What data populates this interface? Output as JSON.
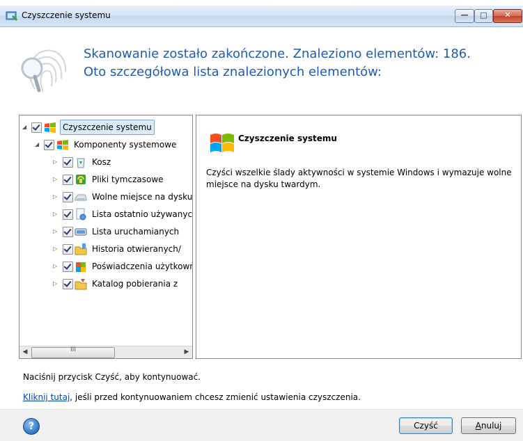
{
  "window": {
    "title": "Czyszczenie systemu"
  },
  "header": {
    "line1": "Skanowanie zostało zakończone. Znaleziono elementów: 186.",
    "line2": "Oto szczegółowa lista znalezionych elementów:"
  },
  "tree": {
    "root": {
      "label": "Czyszczenie systemu",
      "checked": true,
      "expanded": true
    },
    "group": {
      "label": "Komponenty systemowe",
      "checked": true,
      "expanded": true
    },
    "items": [
      {
        "label": "Kosz",
        "icon": "recycle-bin-icon",
        "checked": true
      },
      {
        "label": "Pliki tymczasowe",
        "icon": "temp-files-icon",
        "checked": true
      },
      {
        "label": "Wolne miejsce na dysku",
        "icon": "drive-icon",
        "checked": true
      },
      {
        "label": "Lista ostatnio używanych",
        "icon": "recent-docs-icon",
        "checked": true
      },
      {
        "label": "Lista uruchamianych",
        "icon": "run-list-icon",
        "checked": true
      },
      {
        "label": "Historia otwieranych/",
        "icon": "folder-history-icon",
        "checked": true
      },
      {
        "label": "Poświadczenia użytkownika",
        "icon": "credentials-icon",
        "checked": true
      },
      {
        "label": "Katalog pobierania z",
        "icon": "download-folder-icon",
        "checked": true
      }
    ],
    "scroll_glyph": "III"
  },
  "detail": {
    "title": "Czyszczenie systemu",
    "description": "Czyści wszelkie ślady aktywności w systemie Windows i wymazuje wolne miejsce na dysku twardym."
  },
  "instruction": "Naciśnij przycisk Czyść, aby kontynuować.",
  "link": {
    "text": "Kliknij tutaj",
    "rest": ", jeśli przed kontynuowaniem chcesz zmienić ustawienia czyszczenia."
  },
  "buttons": {
    "clean": "Czyść",
    "cancel_first": "A",
    "cancel_rest": "nuluj",
    "help": "?"
  },
  "colors": {
    "headline": "#1e5bb8",
    "link": "#0645ad",
    "selection": "#dcebfc"
  }
}
